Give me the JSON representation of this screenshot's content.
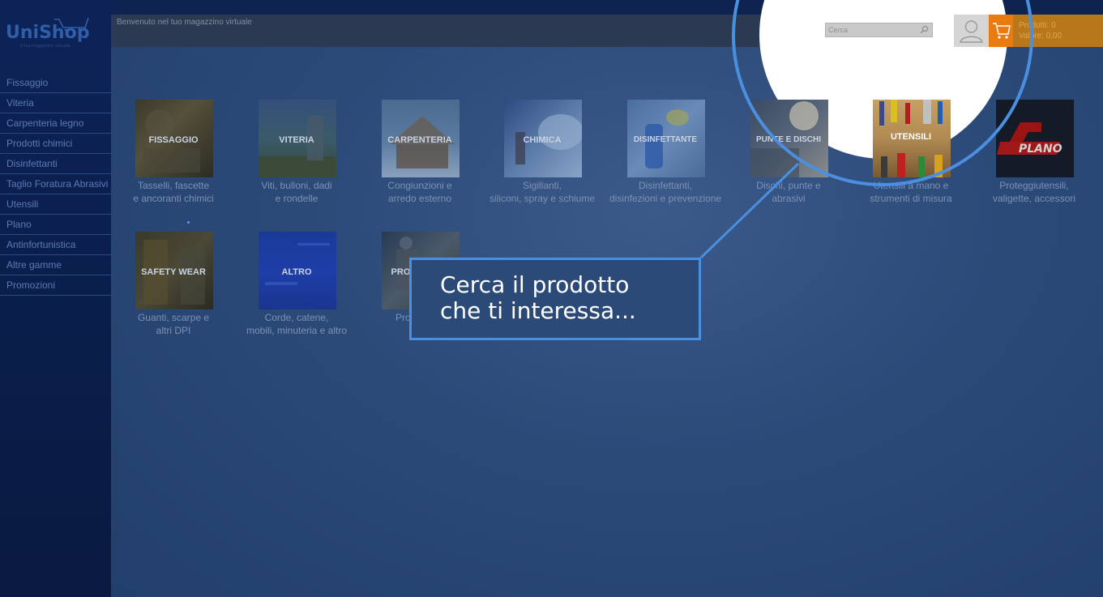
{
  "app": {
    "logo_text": "UniShop",
    "logo_tagline": "il tuo magazzino virtuale",
    "welcome": "Benvenuto nel tuo magazzino virtuale"
  },
  "sidebar": {
    "items": [
      {
        "label": "Fissaggio"
      },
      {
        "label": "Viteria"
      },
      {
        "label": "Carpenteria legno"
      },
      {
        "label": "Prodotti chimici"
      },
      {
        "label": "Disinfettanti"
      },
      {
        "label": "Taglio Foratura Abrasivi"
      },
      {
        "label": "Utensili"
      },
      {
        "label": "Plano"
      },
      {
        "label": "Antinfortunistica"
      },
      {
        "label": "Altre gamme"
      },
      {
        "label": "Promozioni"
      }
    ]
  },
  "search": {
    "placeholder": "Cerca"
  },
  "cart": {
    "products_line": "Prodotti: 0",
    "value_line": "Valore: 0,00"
  },
  "colors": {
    "accent": "#4a8fe0",
    "cart_orange": "#ea7b10",
    "sidebar": "#0d2257"
  },
  "categories": [
    {
      "label": "FISSAGGIO",
      "caption_1": "Tasselli, fascette",
      "caption_2": "e ancoranti chimici",
      "icon": "fissaggio-image"
    },
    {
      "label": "VITERIA",
      "caption_1": "Viti, bulloni, dadi",
      "caption_2": "e rondelle",
      "icon": "viteria-image"
    },
    {
      "label": "CARPENTERIA",
      "caption_1": "Congiunzioni e",
      "caption_2": "arredo esterno",
      "icon": "carpenteria-image"
    },
    {
      "label": "CHIMICA",
      "caption_1": "Sigillanti,",
      "caption_2": "siliconi, spray e schiume",
      "icon": "chimica-image"
    },
    {
      "label": "DISINFETTANTE",
      "caption_1": "Disinfettanti,",
      "caption_2": "disinfezioni e prevenzione",
      "icon": "disinfettante-image"
    },
    {
      "label": "PUNTE E DISCHI",
      "caption_1": "Dischi, punte e",
      "caption_2": "abrasivi",
      "icon": "punte-dischi-image"
    },
    {
      "label": "UTENSILI",
      "caption_1": "Utensili a mano e",
      "caption_2": "strumenti di misura",
      "icon": "utensili-image"
    },
    {
      "label": "PLANO",
      "caption_1": "Proteggiutensili,",
      "caption_2": "valigette, accessori",
      "icon": "plano-logo"
    },
    {
      "label": "SAFETY WEAR",
      "caption_1": "Guanti, scarpe e",
      "caption_2": "altri DPI",
      "icon": "safety-wear-image"
    },
    {
      "label": "ALTRO",
      "caption_1": "Corde, catene,",
      "caption_2": "mobili, minuteria e altro",
      "icon": "altro-image"
    },
    {
      "label": "PROMOZIONI",
      "caption_1": "Promozioni",
      "caption_2": "",
      "icon": "promozioni-image"
    }
  ],
  "callout": {
    "text": "Cerca il prodotto\nche ti interessa..."
  }
}
